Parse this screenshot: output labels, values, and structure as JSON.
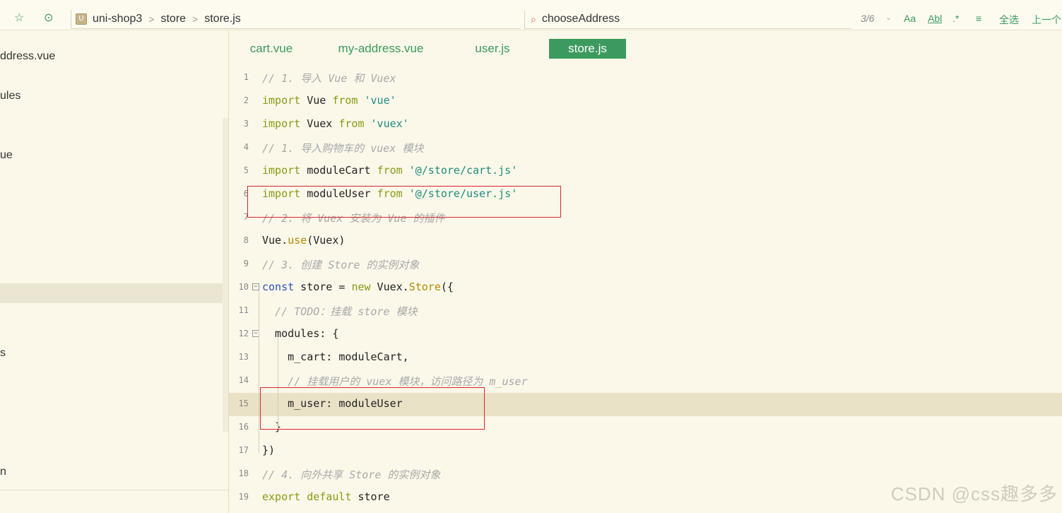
{
  "toolbar": {
    "star_icon": "star-icon",
    "run_icon": "play-circle-icon",
    "breadcrumb": [
      "uni-shop3",
      "store",
      "store.js"
    ],
    "search_value": "chooseAddress",
    "match_count": "3/6",
    "opt_case": "Aa",
    "opt_word": "Abl",
    "opt_regex": ".*",
    "select_all": "全选",
    "prev": "上一个"
  },
  "sidebar": {
    "items": [
      "ddress.vue",
      "ules",
      "ue",
      "s",
      "n"
    ]
  },
  "tabs": [
    "cart.vue",
    "my-address.vue",
    "user.js",
    "store.js"
  ],
  "editor": {
    "line_numbers": [
      "1",
      "2",
      "3",
      "4",
      "5",
      "6",
      "7",
      "8",
      "9",
      "10",
      "11",
      "12",
      "13",
      "14",
      "15",
      "16",
      "17",
      "18",
      "19"
    ],
    "lines": [
      "// 1. 导入 Vue 和 Vuex",
      "import Vue from 'vue'",
      "import Vuex from 'vuex'",
      "// 1. 导入购物车的 vuex 模块",
      "import moduleCart from '@/store/cart.js'",
      "import moduleUser from '@/store/user.js'",
      "// 2. 将 Vuex 安装为 Vue 的插件",
      "Vue.use(Vuex)",
      "// 3. 创建 Store 的实例对象",
      "const store = new Vuex.Store({",
      "  // TODO：挂载 store 模块",
      "  modules: {",
      "    m_cart: moduleCart,",
      "    // 挂载用户的 vuex 模块，访问路径为 m_user",
      "    m_user: moduleUser",
      "  }",
      "})",
      "// 4. 向外共享 Store 的实例对象",
      "export default store"
    ]
  },
  "watermark": "CSDN @css趣多多",
  "colors": {
    "accent": "#3c9a5f",
    "editor_bg": "#fbf8ea",
    "current_line": "#e9e2c7",
    "annotation_box": "#d8252b"
  }
}
